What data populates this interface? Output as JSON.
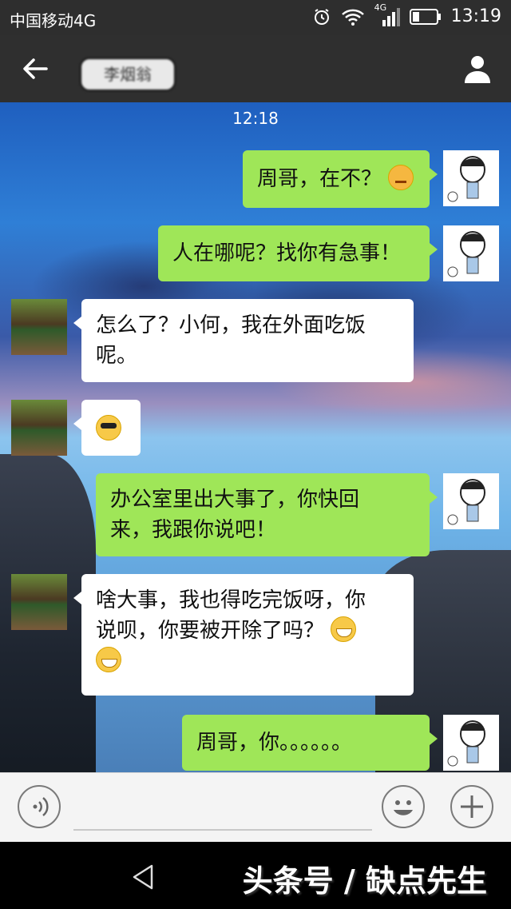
{
  "status_bar": {
    "carrier": "中国移动4G",
    "network": "4G",
    "time": "13:19"
  },
  "header": {
    "contact_name": "李烟翁"
  },
  "chat": {
    "timestamp": "12:18",
    "messages": [
      {
        "from": "me",
        "text": "周哥，在不？",
        "emoji": "angry-face"
      },
      {
        "from": "me",
        "text": "人在哪呢？找你有急事！"
      },
      {
        "from": "other",
        "line1": "怎么了？小何，我在外面吃饭",
        "line2": "呢。"
      },
      {
        "from": "other",
        "emoji": "sunglasses-face"
      },
      {
        "from": "me",
        "line1": "办公室里出大事了，你快回",
        "line2": "来，我跟你说吧！"
      },
      {
        "from": "other",
        "line1": "啥大事，我也得吃完饭呀，你",
        "line2": "说呗，你要被开除了吗？",
        "emoji": "grin-face"
      },
      {
        "from": "me",
        "text": "周哥，你。。。。。。"
      }
    ]
  },
  "input_bar": {
    "placeholder": ""
  },
  "watermark": "头条号 / 缺点先生"
}
